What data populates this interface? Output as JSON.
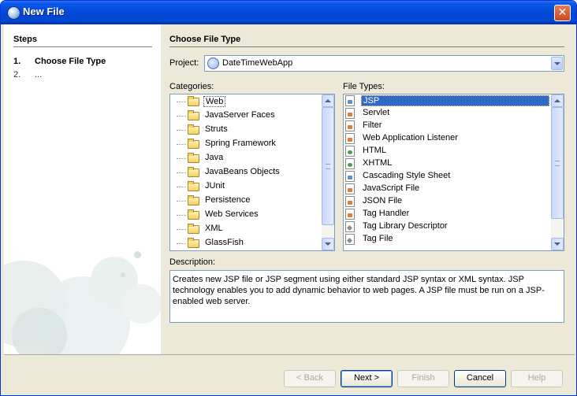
{
  "window": {
    "title": "New File"
  },
  "steps": {
    "title": "Steps",
    "items": [
      {
        "num": "1.",
        "label": "Choose File Type"
      },
      {
        "num": "2.",
        "label": "..."
      }
    ]
  },
  "main": {
    "title": "Choose File Type",
    "project_label": "Project:",
    "project_value": "DateTimeWebApp",
    "categories_label": "Categories:",
    "filetypes_label": "File Types:",
    "description_label": "Description:",
    "description": "Creates new JSP file or JSP segment using either standard JSP syntax or XML syntax. JSP technology enables you to add dynamic behavior to web pages. A JSP file must be run on a JSP-enabled web server."
  },
  "categories": [
    "Web",
    "JavaServer Faces",
    "Struts",
    "Spring Framework",
    "Java",
    "JavaBeans Objects",
    "JUnit",
    "Persistence",
    "Web Services",
    "XML",
    "GlassFish"
  ],
  "file_types": [
    {
      "label": "JSP",
      "icon": "jsp-file-icon"
    },
    {
      "label": "Servlet",
      "icon": "java-file-icon"
    },
    {
      "label": "Filter",
      "icon": "java-file-icon"
    },
    {
      "label": "Web Application Listener",
      "icon": "java-file-icon"
    },
    {
      "label": "HTML",
      "icon": "html-file-icon"
    },
    {
      "label": "XHTML",
      "icon": "html-file-icon"
    },
    {
      "label": "Cascading Style Sheet",
      "icon": "css-file-icon"
    },
    {
      "label": "JavaScript File",
      "icon": "js-file-icon"
    },
    {
      "label": "JSON File",
      "icon": "js-file-icon"
    },
    {
      "label": "Tag Handler",
      "icon": "java-file-icon"
    },
    {
      "label": "Tag Library Descriptor",
      "icon": "tld-file-icon"
    },
    {
      "label": "Tag File",
      "icon": "tag-file-icon"
    }
  ],
  "buttons": {
    "back": "< Back",
    "next": "Next >",
    "finish": "Finish",
    "cancel": "Cancel",
    "help": "Help"
  }
}
